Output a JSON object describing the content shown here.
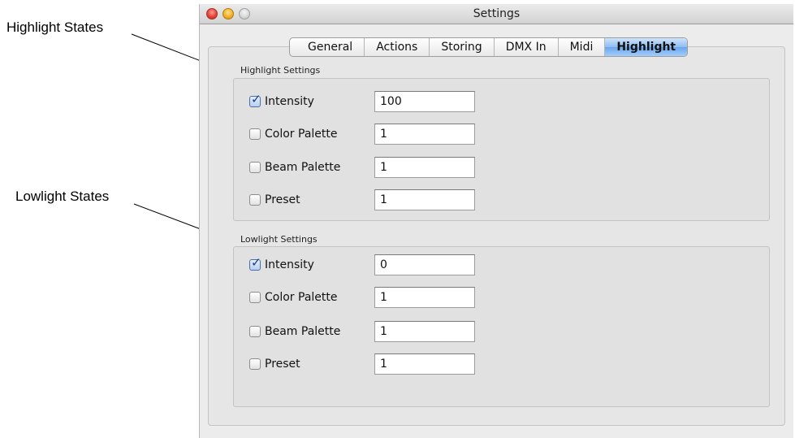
{
  "callouts": {
    "highlight": "Highlight States",
    "lowlight": "Lowlight States"
  },
  "window": {
    "title": "Settings"
  },
  "tabs": [
    {
      "label": "General",
      "active": false
    },
    {
      "label": "Actions",
      "active": false
    },
    {
      "label": "Storing",
      "active": false
    },
    {
      "label": "DMX In",
      "active": false
    },
    {
      "label": "Midi",
      "active": false
    },
    {
      "label": "Highlight",
      "active": true
    }
  ],
  "highlight_settings": {
    "title": "Highlight Settings",
    "rows": [
      {
        "label": "Intensity",
        "checked": true,
        "value": "100"
      },
      {
        "label": "Color Palette",
        "checked": false,
        "value": "1"
      },
      {
        "label": "Beam Palette",
        "checked": false,
        "value": "1"
      },
      {
        "label": "Preset",
        "checked": false,
        "value": "1"
      }
    ]
  },
  "lowlight_settings": {
    "title": "Lowlight Settings",
    "rows": [
      {
        "label": "Intensity",
        "checked": true,
        "value": "0"
      },
      {
        "label": "Color Palette",
        "checked": false,
        "value": "1"
      },
      {
        "label": "Beam Palette",
        "checked": false,
        "value": "1"
      },
      {
        "label": "Preset",
        "checked": false,
        "value": "1"
      }
    ]
  },
  "icons": {
    "close": "close-button-icon",
    "minimize": "minimize-button-icon",
    "zoom": "zoom-button-icon",
    "check": "checkmark-icon"
  }
}
